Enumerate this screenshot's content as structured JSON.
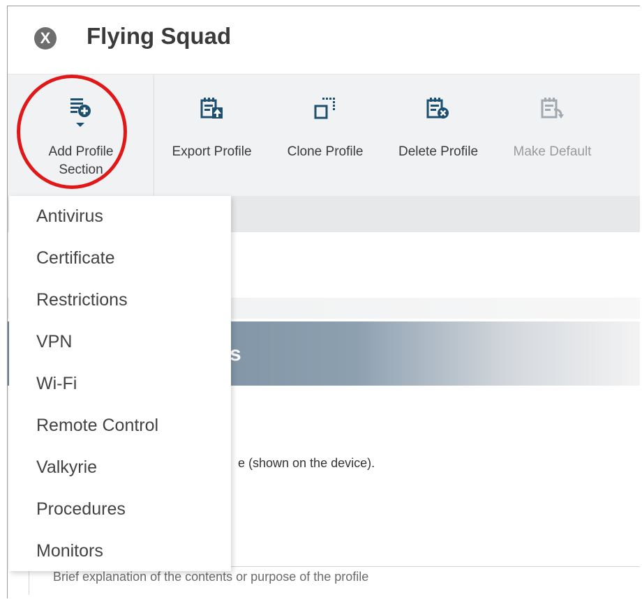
{
  "window": {
    "title": "Flying Squad",
    "close_glyph": "X"
  },
  "toolbar": {
    "buttons": [
      {
        "label_line1": "Add Profile",
        "label_line2": "Section",
        "icon": "add-section-icon"
      },
      {
        "label": "Export Profile",
        "icon": "export-icon"
      },
      {
        "label": "Clone Profile",
        "icon": "clone-icon"
      },
      {
        "label": "Delete Profile",
        "icon": "delete-icon"
      },
      {
        "label": "Make Default",
        "icon": "make-default-icon",
        "disabled": true
      }
    ]
  },
  "menu": {
    "items": [
      "Antivirus",
      "Certificate",
      "Restrictions",
      "VPN",
      "Wi-Fi",
      "Remote Control",
      "Valkyrie",
      "Procedures",
      "Monitors"
    ]
  },
  "content": {
    "section_title_fragment": "s",
    "name_hint_fragment": "e (shown on the device).",
    "description_placeholder": "Brief explanation of the contents or purpose of the profile"
  },
  "colors": {
    "highlight_circle": "#e01818",
    "section_bar": "#6e8599"
  }
}
